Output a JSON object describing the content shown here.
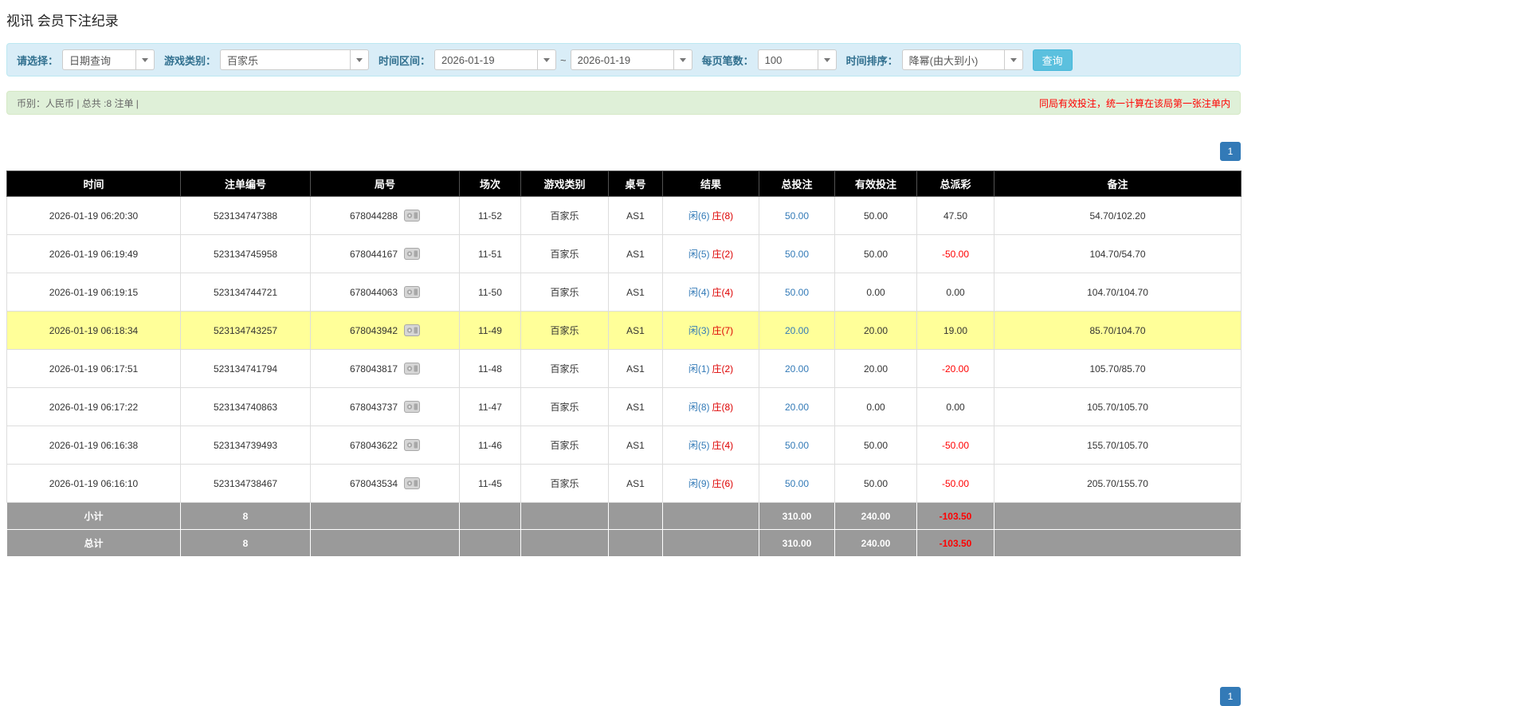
{
  "page": {
    "title": "视讯 会员下注纪录"
  },
  "filters": {
    "select_label": "请选择：",
    "select_value": "日期查询",
    "game_type_label": "游戏类别：",
    "game_type_value": "百家乐",
    "time_range_label": "时间区间：",
    "date_from": "2026-01-19",
    "date_separator": "~",
    "date_to": "2026-01-19",
    "page_size_label": "每页笔数：",
    "page_size_value": "100",
    "sort_label": "时间排序：",
    "sort_value": "降幂(由大到小)",
    "search_button": "查询"
  },
  "summary": {
    "left_text": "币别：人民币 | 总共 :8 注单 |",
    "right_notice": "同局有效投注，统一计算在该局第一张注单内"
  },
  "pagination": {
    "page": "1"
  },
  "colors": {
    "accent_blue": "#337ab7",
    "link_blue": "#337ab7",
    "player_blue": "#337ab7",
    "banker_red": "#dd0000",
    "negative_red": "#ff0000",
    "highlight_yellow": "#ffff99",
    "header_black": "#000000",
    "footer_gray": "#9a9a9a"
  },
  "table": {
    "headers": [
      "时间",
      "注单编号",
      "局号",
      "场次",
      "游戏类别",
      "桌号",
      "结果",
      "总投注",
      "有效投注",
      "总派彩",
      "备注"
    ],
    "rows": [
      {
        "time": "2026-01-19 06:20:30",
        "bet_id": "523134747388",
        "round_id": "678044288",
        "session": "11-52",
        "game": "百家乐",
        "table_no": "AS1",
        "result_player": "闲(6)",
        "result_banker": "庄(8)",
        "total_bet": "50.00",
        "valid_bet": "50.00",
        "payout": "47.50",
        "note": "54.70/102.20",
        "highlighted": false
      },
      {
        "time": "2026-01-19 06:19:49",
        "bet_id": "523134745958",
        "round_id": "678044167",
        "session": "11-51",
        "game": "百家乐",
        "table_no": "AS1",
        "result_player": "闲(5)",
        "result_banker": "庄(2)",
        "total_bet": "50.00",
        "valid_bet": "50.00",
        "payout": "-50.00",
        "note": "104.70/54.70",
        "highlighted": false
      },
      {
        "time": "2026-01-19 06:19:15",
        "bet_id": "523134744721",
        "round_id": "678044063",
        "session": "11-50",
        "game": "百家乐",
        "table_no": "AS1",
        "result_player": "闲(4)",
        "result_banker": "庄(4)",
        "total_bet": "50.00",
        "valid_bet": "0.00",
        "payout": "0.00",
        "note": "104.70/104.70",
        "highlighted": false
      },
      {
        "time": "2026-01-19 06:18:34",
        "bet_id": "523134743257",
        "round_id": "678043942",
        "session": "11-49",
        "game": "百家乐",
        "table_no": "AS1",
        "result_player": "闲(3)",
        "result_banker": "庄(7)",
        "total_bet": "20.00",
        "valid_bet": "20.00",
        "payout": "19.00",
        "note": "85.70/104.70",
        "highlighted": true
      },
      {
        "time": "2026-01-19 06:17:51",
        "bet_id": "523134741794",
        "round_id": "678043817",
        "session": "11-48",
        "game": "百家乐",
        "table_no": "AS1",
        "result_player": "闲(1)",
        "result_banker": "庄(2)",
        "total_bet": "20.00",
        "valid_bet": "20.00",
        "payout": "-20.00",
        "note": "105.70/85.70",
        "highlighted": false
      },
      {
        "time": "2026-01-19 06:17:22",
        "bet_id": "523134740863",
        "round_id": "678043737",
        "session": "11-47",
        "game": "百家乐",
        "table_no": "AS1",
        "result_player": "闲(8)",
        "result_banker": "庄(8)",
        "total_bet": "20.00",
        "valid_bet": "0.00",
        "payout": "0.00",
        "note": "105.70/105.70",
        "highlighted": false
      },
      {
        "time": "2026-01-19 06:16:38",
        "bet_id": "523134739493",
        "round_id": "678043622",
        "session": "11-46",
        "game": "百家乐",
        "table_no": "AS1",
        "result_player": "闲(5)",
        "result_banker": "庄(4)",
        "total_bet": "50.00",
        "valid_bet": "50.00",
        "payout": "-50.00",
        "note": "155.70/105.70",
        "highlighted": false
      },
      {
        "time": "2026-01-19 06:16:10",
        "bet_id": "523134738467",
        "round_id": "678043534",
        "session": "11-45",
        "game": "百家乐",
        "table_no": "AS1",
        "result_player": "闲(9)",
        "result_banker": "庄(6)",
        "total_bet": "50.00",
        "valid_bet": "50.00",
        "payout": "-50.00",
        "note": "205.70/155.70",
        "highlighted": false
      }
    ],
    "footer": [
      {
        "label": "小计",
        "count": "8",
        "total_bet": "310.00",
        "valid_bet": "240.00",
        "payout": "-103.50"
      },
      {
        "label": "总计",
        "count": "8",
        "total_bet": "310.00",
        "valid_bet": "240.00",
        "payout": "-103.50"
      }
    ]
  }
}
